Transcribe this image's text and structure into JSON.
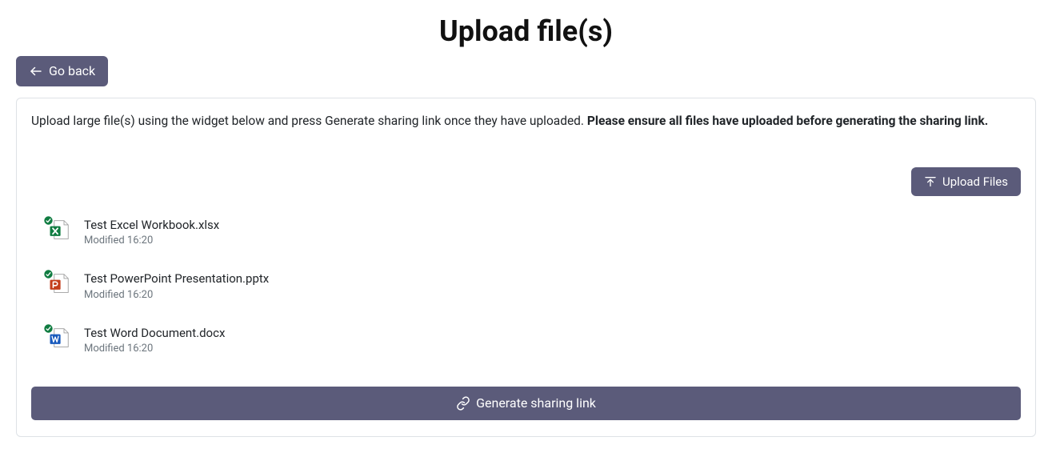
{
  "page": {
    "title": "Upload file(s)"
  },
  "buttons": {
    "go_back": "Go back",
    "upload_files": "Upload Files",
    "generate_link": "Generate sharing link"
  },
  "instructions": {
    "text_plain": "Upload large file(s) using the widget below and press Generate sharing link once they have uploaded. ",
    "text_bold": "Please ensure all files have uploaded before generating the sharing link."
  },
  "files": [
    {
      "name": "Test Excel Workbook.xlsx",
      "modified": "Modified 16:20",
      "type": "excel"
    },
    {
      "name": "Test PowerPoint Presentation.pptx",
      "modified": "Modified 16:20",
      "type": "powerpoint"
    },
    {
      "name": "Test Word Document.docx",
      "modified": "Modified 16:20",
      "type": "word"
    }
  ],
  "icons": {
    "arrow_left": "arrow-left-icon",
    "upload": "upload-icon",
    "link": "link-icon",
    "check": "check-icon"
  },
  "colors": {
    "excel": "#107c41",
    "powerpoint": "#c43e1c",
    "word": "#185abd",
    "accent": "#5b5b7a"
  }
}
